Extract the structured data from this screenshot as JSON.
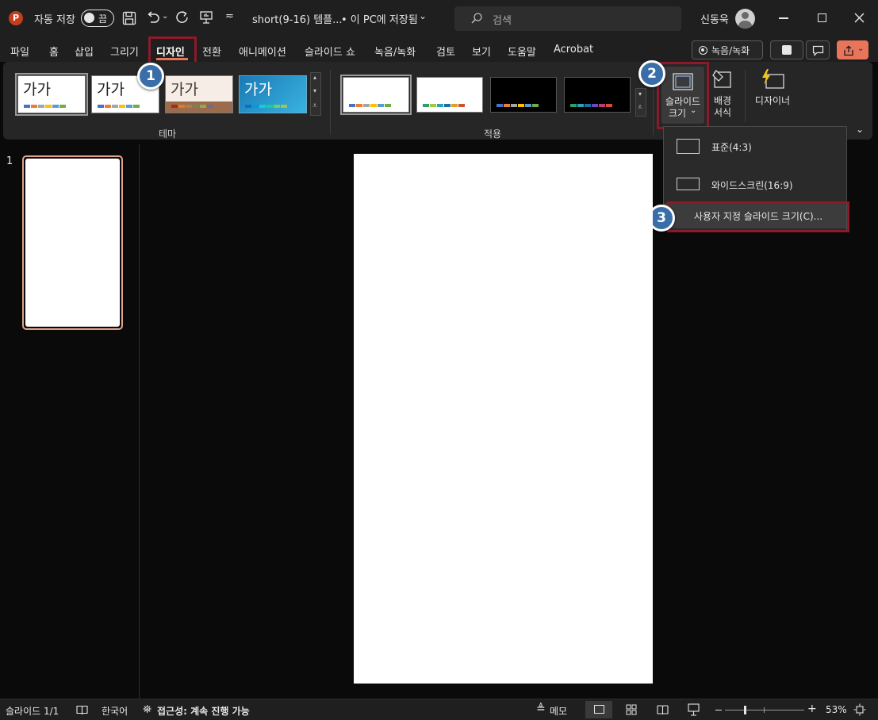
{
  "titlebar": {
    "autosave_label": "자동 저장",
    "toggle_label": "끔",
    "filename": "short(9-16) 템플...",
    "save_status": "• 이 PC에 저장됨",
    "search_placeholder": "검색",
    "user_name": "신동욱"
  },
  "tabs": [
    "파일",
    "홈",
    "삽입",
    "그리기",
    "디자인",
    "전환",
    "애니메이션",
    "슬라이드 쇼",
    "녹음/녹화",
    "검토",
    "보기",
    "도움말",
    "Acrobat"
  ],
  "right_buttons": {
    "record_label": "녹음/녹화"
  },
  "ribbon": {
    "themes": [
      {
        "label": "가가",
        "style": "white"
      },
      {
        "label": "가가",
        "style": "white"
      },
      {
        "label": "가가",
        "style": "wood"
      },
      {
        "label": "가가",
        "style": "blue"
      }
    ],
    "theme_group_label": "테마",
    "variant_group_label": "적용",
    "slide_size_label_1": "슬라이드",
    "slide_size_label_2": "크기",
    "background_label_1": "배경",
    "background_label_2": "서식",
    "designer_label": "디자이너"
  },
  "dropdown": {
    "items": [
      "표준(4:3)",
      "와이드스크린(16:9)",
      "사용자 지정 슬라이드 크기(C)..."
    ]
  },
  "steps": [
    "1",
    "2",
    "3"
  ],
  "slidepane": {
    "slide_number": "1"
  },
  "statusbar": {
    "slide_count": "슬라이드 1/1",
    "language": "한국어",
    "accessibility": "접근성: 계속 진행 가능",
    "notes": "메모",
    "zoom": "53%"
  },
  "colors": {
    "accent": "#e8755a",
    "highlight_border": "#8b1a2a",
    "step_badge": "#3a6ea8",
    "share_button": "#e8755a"
  }
}
